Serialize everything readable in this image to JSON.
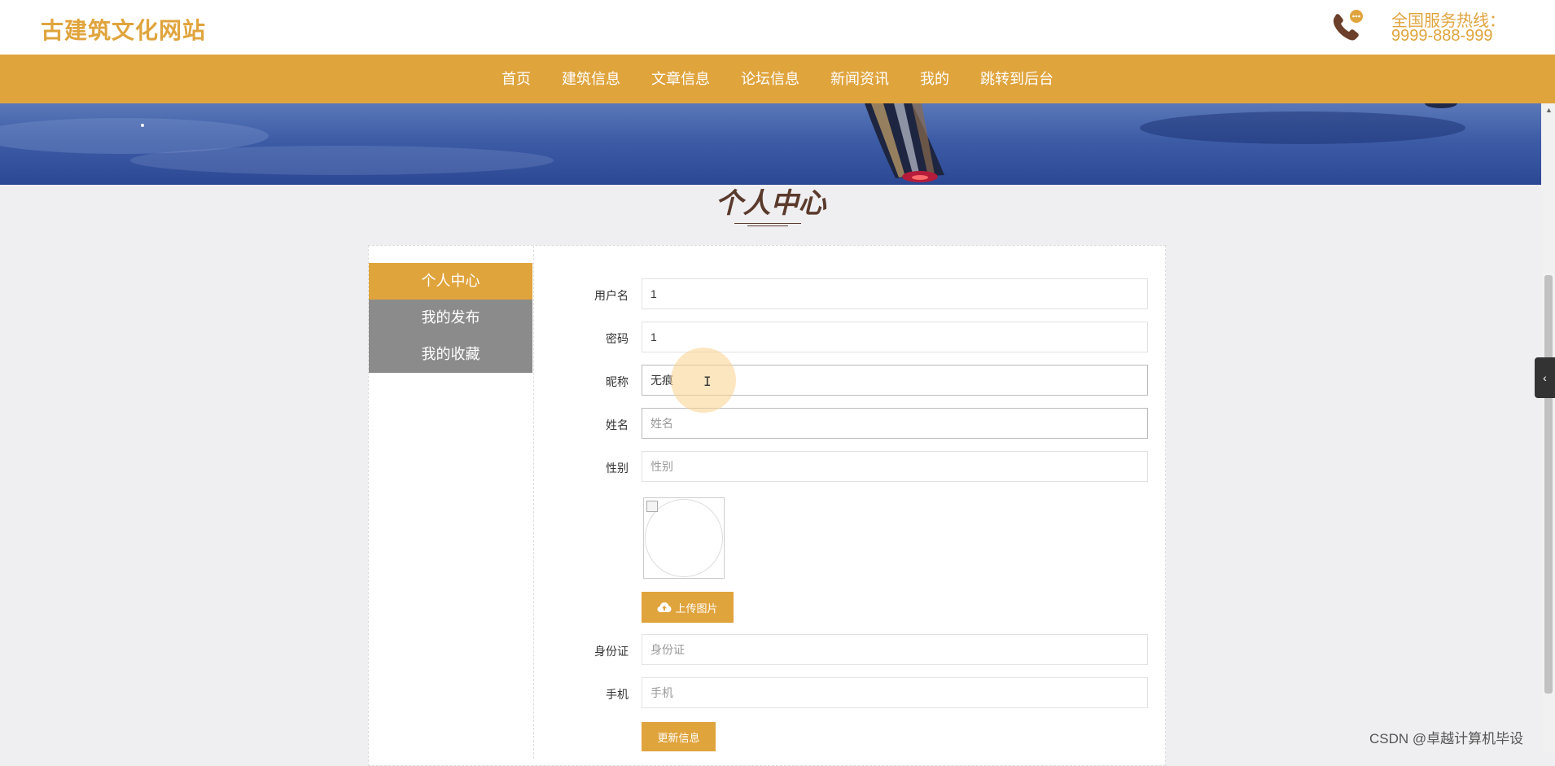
{
  "header": {
    "site_title": "古建筑文化网站",
    "hotline_label": "全国服务热线：",
    "hotline_number": "9999-888-999",
    "phone_icon": "phone-chat-icon"
  },
  "nav": {
    "items": [
      {
        "label": "首页"
      },
      {
        "label": "建筑信息"
      },
      {
        "label": "文章信息"
      },
      {
        "label": "论坛信息"
      },
      {
        "label": "新闻资讯"
      },
      {
        "label": "我的"
      },
      {
        "label": "跳转到后台"
      }
    ]
  },
  "page": {
    "title": "个人中心"
  },
  "sidebar": {
    "items": [
      {
        "label": "个人中心",
        "active": true
      },
      {
        "label": "我的发布",
        "active": false
      },
      {
        "label": "我的收藏",
        "active": false
      }
    ]
  },
  "form": {
    "username": {
      "label": "用户名",
      "value": "1",
      "placeholder": ""
    },
    "password": {
      "label": "密码",
      "value": "1",
      "placeholder": ""
    },
    "nickname": {
      "label": "昵称",
      "value": "无痕",
      "placeholder": ""
    },
    "name": {
      "label": "姓名",
      "value": "",
      "placeholder": "姓名"
    },
    "gender": {
      "label": "性别",
      "value": "",
      "placeholder": "性别"
    },
    "upload_button": "上传图片",
    "upload_icon": "cloud-upload-icon",
    "id_card": {
      "label": "身份证",
      "value": "",
      "placeholder": "身份证"
    },
    "phone": {
      "label": "手机",
      "value": "",
      "placeholder": "手机"
    },
    "update_button": "更新信息"
  },
  "colors": {
    "accent": "#e0a43d",
    "sidebar_inactive": "#8b8b8b",
    "title_brown": "#5a3a2c"
  },
  "watermark": "CSDN @卓越计算机毕设"
}
